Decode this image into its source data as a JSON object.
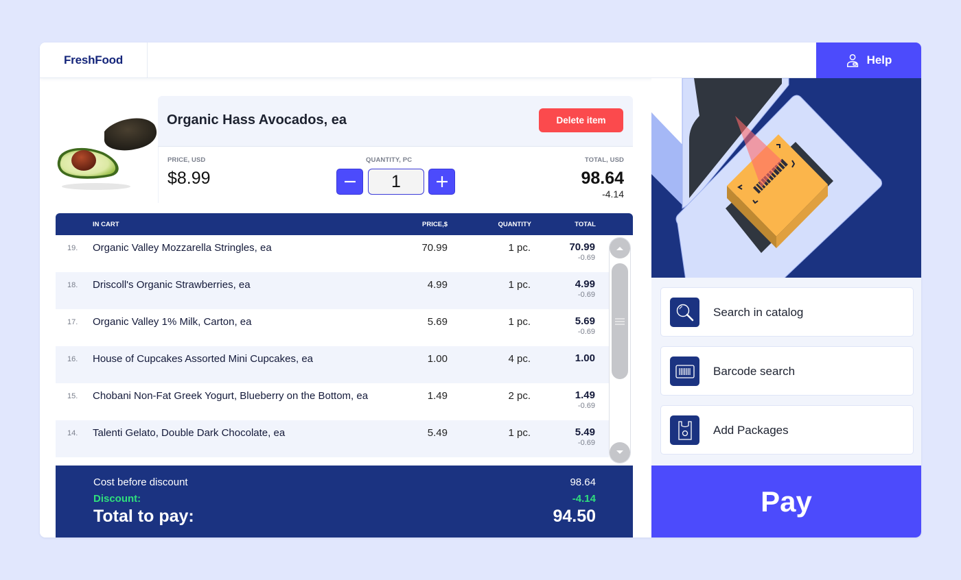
{
  "header": {
    "brand": "FreshFood",
    "help_label": "Help",
    "help_icon": "user-support-icon"
  },
  "product": {
    "image": "avocado-image",
    "name": "Organic Hass Avocados, ea",
    "delete_label": "Delete item",
    "price_label": "PRICE, USD",
    "price": "$8.99",
    "quantity_label": "QUANTITY, PC",
    "quantity": "1",
    "total_label": "TOTAL, USD",
    "total": "98.64",
    "total_discount": "-4.14"
  },
  "cart": {
    "columns": {
      "item": "IN CART",
      "price": "PRICE,$",
      "quantity": "QUANTITY",
      "total": "TOTAL"
    },
    "rows": [
      {
        "num": "19.",
        "name": "Organic Valley Mozzarella Stringles, ea",
        "price": "70.99",
        "qty": "1 pc.",
        "total": "70.99",
        "discount": "-0.69"
      },
      {
        "num": "18.",
        "name": "Driscoll's Organic Strawberries, ea",
        "price": "4.99",
        "qty": "1 pc.",
        "total": "4.99",
        "discount": "-0.69"
      },
      {
        "num": "17.",
        "name": "Organic Valley 1% Milk, Carton, ea",
        "price": "5.69",
        "qty": "1 pc.",
        "total": "5.69",
        "discount": "-0.69"
      },
      {
        "num": "16.",
        "name": "House of Cupcakes Assorted Mini Cupcakes, ea",
        "price": "1.00",
        "qty": "4 pc.",
        "total": "1.00",
        "discount": ""
      },
      {
        "num": "15.",
        "name": "Chobani Non-Fat Greek Yogurt, Blueberry on the Bottom, ea",
        "price": "1.49",
        "qty": "2 pc.",
        "total": "1.49",
        "discount": "-0.69"
      },
      {
        "num": "14.",
        "name": "Talenti Gelato, Double Dark Chocolate, ea",
        "price": "5.49",
        "qty": "1 pc.",
        "total": "5.49",
        "discount": "-0.69"
      }
    ]
  },
  "summary": {
    "cost_label": "Cost before discount",
    "cost_value": "98.64",
    "discount_label": "Discount:",
    "discount_value": "-4.14",
    "total_label": "Total to pay:",
    "total_value": "94.50"
  },
  "actions": [
    {
      "label": "Search in catalog",
      "icon": "magnifier-icon"
    },
    {
      "label": "Barcode search",
      "icon": "barcode-icon"
    },
    {
      "label": "Add Packages",
      "icon": "shopping-bag-icon"
    }
  ],
  "pay_label": "Pay",
  "colors": {
    "accent": "#4c4bfc",
    "navy": "#1b3381",
    "danger": "#fb4a4d",
    "discount_green": "#2fe07c",
    "page_bg": "#e1e7fd"
  }
}
